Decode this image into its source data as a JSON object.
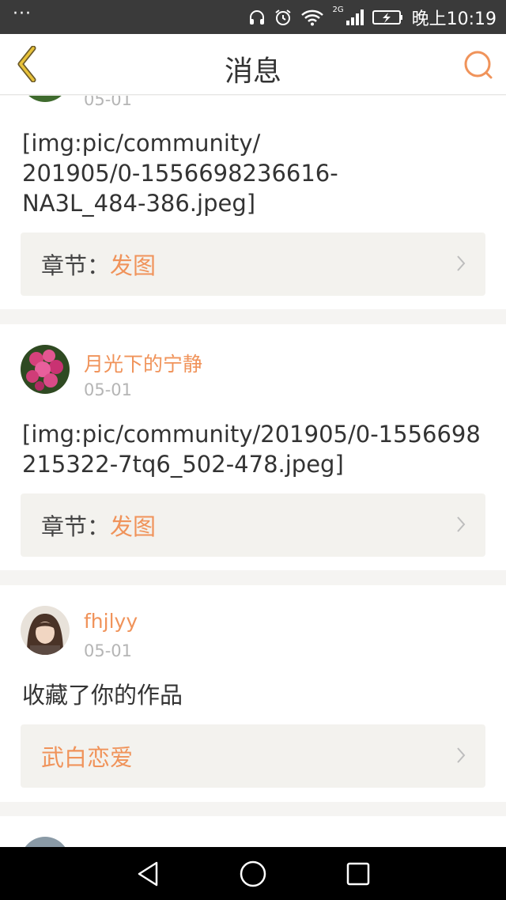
{
  "status_bar": {
    "notification_icon": "more-dots-icon",
    "network": "2G",
    "time": "晚上10:19"
  },
  "header": {
    "title": "消息",
    "back_icon": "back-chevron-icon",
    "search_icon": "search-icon"
  },
  "feed": [
    {
      "date": "05-01",
      "content": "[img:pic/community/\n201905/0-1556698236616-\nNA3L_484-386.jpeg]",
      "ref_label": "章节：",
      "ref_value": "发图"
    },
    {
      "username": "月光下的宁静",
      "date": "05-01",
      "content": "[img:pic/community/201905/0-1556698215322-7tq6_502-478.jpeg]",
      "ref_label": "章节：",
      "ref_value": "发图"
    },
    {
      "username": "fhjlyy",
      "date": "05-01",
      "content": "收藏了你的作品",
      "ref_value": "武白恋爱"
    }
  ],
  "colors": {
    "accent": "#f0935a",
    "status_bar": "#3a3a3a",
    "ref_bg": "#f3f2ee",
    "date": "#b5b5b5"
  }
}
